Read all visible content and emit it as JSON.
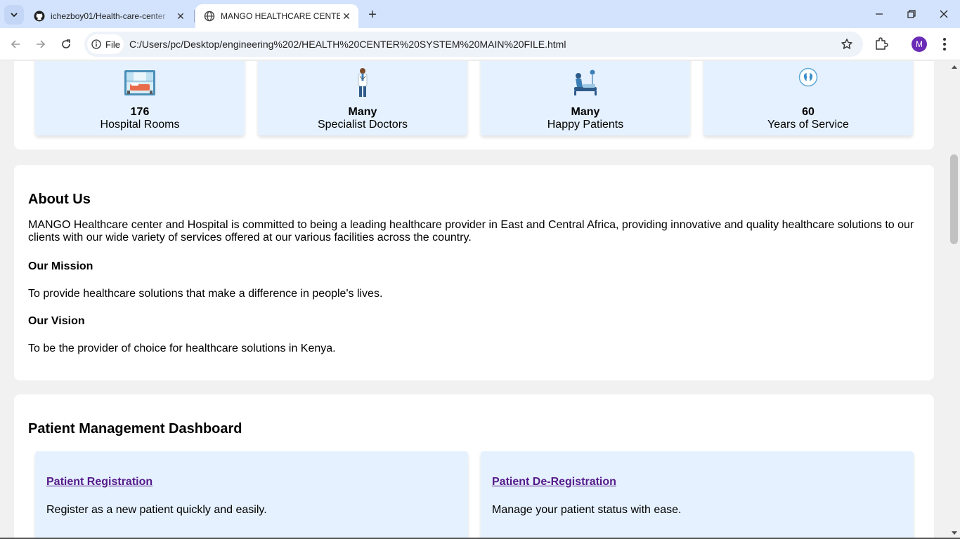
{
  "browser": {
    "tabs": [
      {
        "title": "ichezboy01/Health-care-center",
        "icon": "github-icon",
        "active": false
      },
      {
        "title": "MANGO HEALTHCARE CENTER",
        "icon": "globe-icon",
        "active": true
      }
    ],
    "address_bar": {
      "chip_label": "File",
      "url": "C:/Users/pc/Desktop/engineering%202/HEALTH%20CENTER%20SYSTEM%20MAIN%20FILE.html"
    },
    "profile_initial": "M"
  },
  "stats": [
    {
      "value": "176",
      "label": "Hospital Rooms",
      "icon": "hospital-room-icon"
    },
    {
      "value": "Many",
      "label": "Specialist Doctors",
      "icon": "doctor-icon"
    },
    {
      "value": "Many",
      "label": "Happy Patients",
      "icon": "patient-bed-icon"
    },
    {
      "value": "60",
      "label": "Years of Service",
      "icon": "kidneys-icon"
    }
  ],
  "about": {
    "heading": "About Us",
    "intro": "MANGO Healthcare center and Hospital is committed to being a leading healthcare provider in East and Central Africa, providing innovative and quality healthcare solutions to our clients with our wide variety of services offered at our various facilities across the country.",
    "mission_heading": "Our Mission",
    "mission_text": "To provide healthcare solutions that make a difference in people's lives.",
    "vision_heading": "Our Vision",
    "vision_text": "To be the provider of choice for healthcare solutions in Kenya."
  },
  "dashboard": {
    "heading": "Patient Management Dashboard",
    "items": [
      {
        "title": "Patient Registration",
        "description": "Register as a new patient quickly and easily."
      },
      {
        "title": "Patient De-Registration",
        "description": "Manage your patient status with ease."
      }
    ]
  },
  "colors": {
    "tabstrip": "#d3e3fd",
    "stat_box": "#e5f1fe",
    "link_visited": "#551a8b",
    "avatar": "#6a2bb6"
  }
}
